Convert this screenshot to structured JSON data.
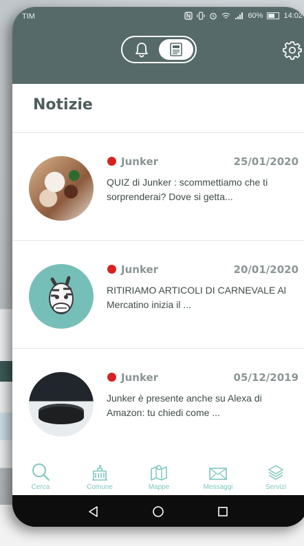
{
  "status_bar": {
    "carrier": "TIM",
    "battery": "60%",
    "time": "14:02"
  },
  "header": {
    "toggle_left_icon": "bell-icon",
    "toggle_right_icon": "newspaper-icon",
    "settings_icon": "gear-icon"
  },
  "page": {
    "title": "Notizie"
  },
  "news": [
    {
      "source": "Junker",
      "date": "25/01/2020",
      "excerpt": "QUIZ di Junker : scommettiamo che ti sorprenderai? Dove si getta...",
      "dot_color": "#d92121",
      "thumb": "food-photo"
    },
    {
      "source": "Junker",
      "date": "20/01/2020",
      "excerpt": "RITIRIAMO ARTICOLI DI CARNEVALE Al Mercatino inizia il ...",
      "dot_color": "#d92121",
      "thumb": "zebra-mascot"
    },
    {
      "source": "Junker",
      "date": "05/12/2019",
      "excerpt": "Junker è presente anche su Alexa di Amazon: tu chiedi come ...",
      "dot_color": "#d92121",
      "thumb": "alexa-speaker"
    }
  ],
  "bottom_nav": [
    {
      "label": "Cerca",
      "icon": "search-icon"
    },
    {
      "label": "Comune",
      "icon": "town-hall-icon"
    },
    {
      "label": "Mappe",
      "icon": "map-icon"
    },
    {
      "label": "Messaggi",
      "icon": "mail-icon"
    },
    {
      "label": "Servizi",
      "icon": "layers-icon"
    }
  ],
  "colors": {
    "header": "#566b69",
    "accent": "#7fc7c1",
    "dot": "#d92121"
  }
}
